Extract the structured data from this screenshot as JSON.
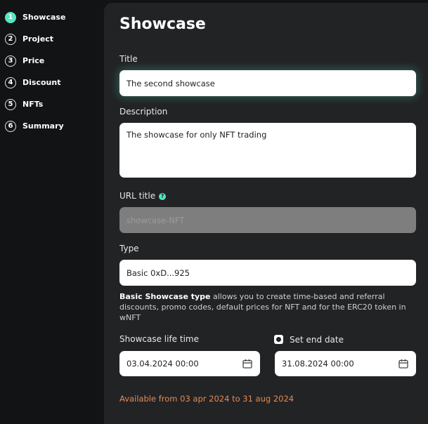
{
  "steps": [
    {
      "num": "1",
      "label": "Showcase"
    },
    {
      "num": "2",
      "label": "Project"
    },
    {
      "num": "3",
      "label": "Price"
    },
    {
      "num": "4",
      "label": "Discount"
    },
    {
      "num": "5",
      "label": "NFTs"
    },
    {
      "num": "6",
      "label": "Summary"
    }
  ],
  "panel": {
    "title": "Showcase"
  },
  "form": {
    "title_label": "Title",
    "title_value": "The second showcase",
    "description_label": "Description",
    "description_value": "The showcase for only NFT trading",
    "url_label": "URL title",
    "url_help": "?",
    "url_value": "showcase-NFT",
    "type_label": "Type",
    "type_value": "Basic 0xD...925",
    "type_note_bold": "Basic Showcase type",
    "type_note_rest": " allows you to create time-based and referral discounts, promo codes, default prices for NFT and for the ERC20 token in wNFT",
    "lifetime_label": "Showcase life time",
    "start_date": "03.04.2024 00:00",
    "end_date_label": "Set end date",
    "end_date": "31.08.2024 00:00",
    "availability": "Available from 03 apr 2024 to 31 aug 2024"
  },
  "colors": {
    "accent": "#54e7c3",
    "availability": "#e48a54",
    "panel": "#222325",
    "background": "#121314"
  }
}
